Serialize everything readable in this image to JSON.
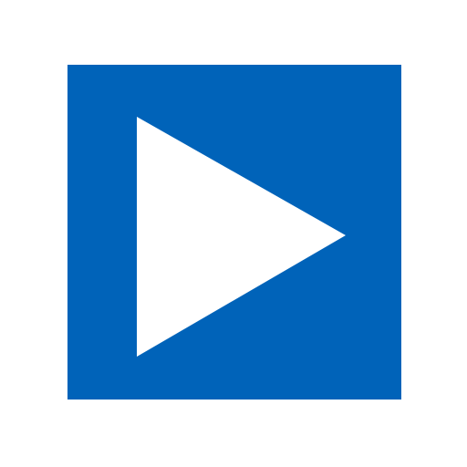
{
  "icon": {
    "name": "play-icon",
    "background_color": "#0063b9",
    "glyph_color": "#ffffff"
  },
  "page": {
    "background_color": "#ffffff"
  }
}
